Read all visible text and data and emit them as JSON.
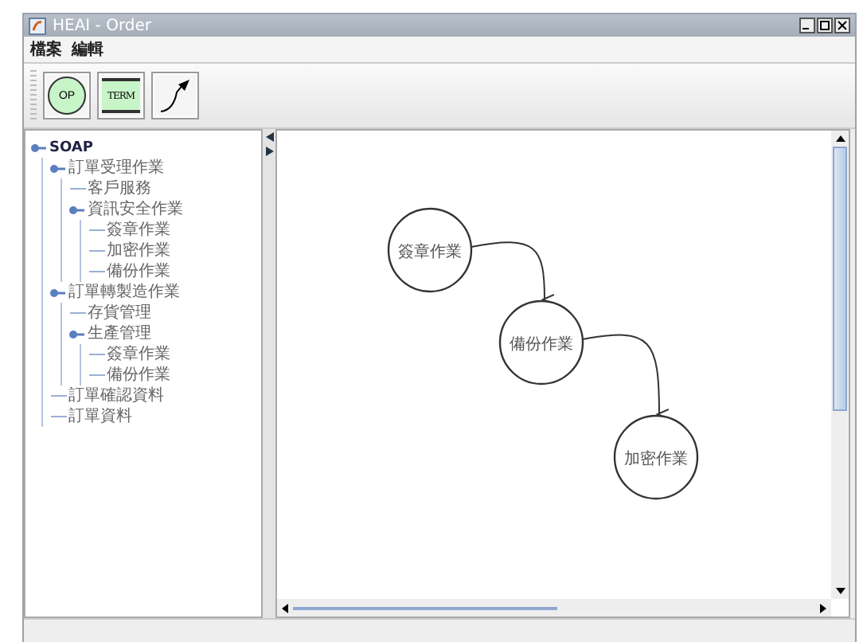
{
  "window": {
    "title": "HEAI - Order"
  },
  "menu": [
    "檔案",
    "編輯"
  ],
  "toolbar": [
    {
      "kind": "op",
      "label": "OP"
    },
    {
      "kind": "term",
      "label": "TERM"
    },
    {
      "kind": "connector"
    }
  ],
  "tree": [
    {
      "label": "SOAP",
      "expanded": true,
      "children": [
        {
          "label": "訂單受理作業",
          "expanded": true,
          "children": [
            {
              "label": "客戶服務"
            },
            {
              "label": "資訊安全作業",
              "expanded": true,
              "children": [
                {
                  "label": "簽章作業"
                },
                {
                  "label": "加密作業"
                },
                {
                  "label": "備份作業"
                }
              ]
            }
          ]
        },
        {
          "label": "訂單轉製造作業",
          "expanded": true,
          "children": [
            {
              "label": "存貨管理"
            },
            {
              "label": "生產管理",
              "expanded": true,
              "children": [
                {
                  "label": "簽章作業"
                },
                {
                  "label": "備份作業"
                }
              ]
            }
          ]
        },
        {
          "label": "訂單確認資料"
        },
        {
          "label": "訂單資料"
        }
      ]
    }
  ],
  "diagram": {
    "nodes": [
      {
        "label": "簽章作業"
      },
      {
        "label": "備份作業"
      },
      {
        "label": "加密作業"
      }
    ]
  }
}
